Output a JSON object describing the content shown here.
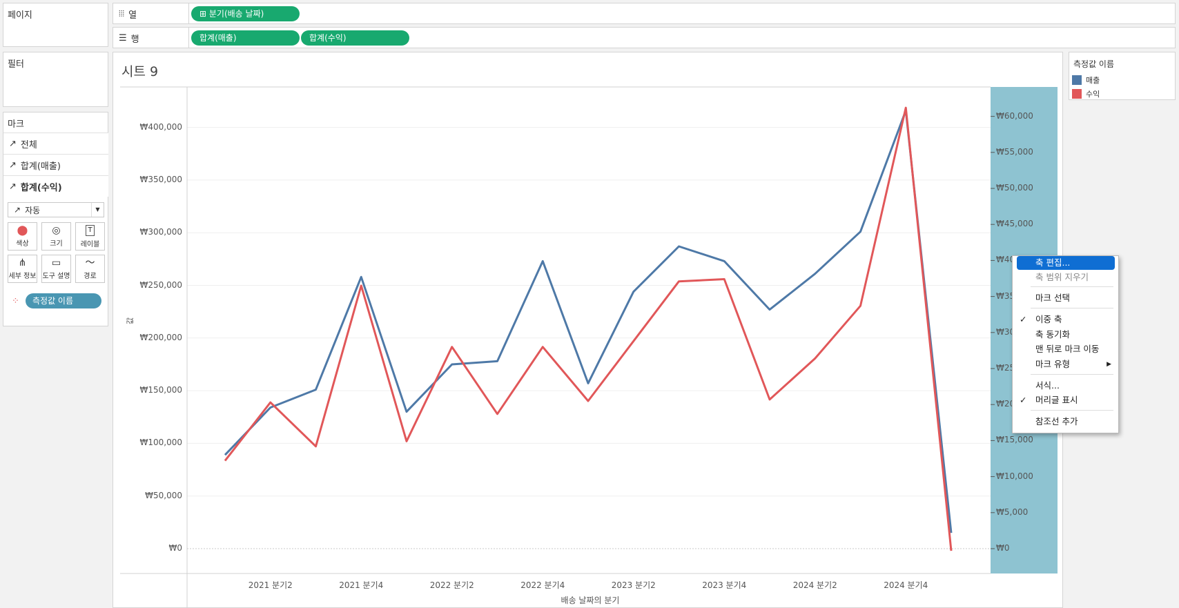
{
  "colors": {
    "sales": "#4e79a7",
    "profit": "#e15759",
    "pill": "#18a96f",
    "measure_pill": "#4996b2",
    "axis_highlight": "#8ec3d1",
    "menu_selected": "#0f6ed3"
  },
  "pages_shelf": {
    "label": "페이지"
  },
  "filters_shelf": {
    "label": "필터"
  },
  "columns_shelf": {
    "icon": "columns-icon",
    "label": "열",
    "pills": [
      "⊞ 분기(배송 날짜)"
    ]
  },
  "rows_shelf": {
    "icon": "rows-icon",
    "label": "행",
    "pills": [
      "합계(매출)",
      "합계(수익)"
    ]
  },
  "marks": {
    "label": "마크",
    "cards": [
      "전체",
      "합계(매출)",
      "합계(수익)"
    ],
    "mark_type": "자동",
    "buttons": [
      "색상",
      "크기",
      "레이블",
      "세부 정보",
      "도구 설명",
      "경로"
    ],
    "color_pill": "측정값 이름"
  },
  "sheet": {
    "title": "시트 9"
  },
  "legend": {
    "title": "측정값 이름",
    "items": [
      {
        "label": "매출",
        "color": "#4e79a7"
      },
      {
        "label": "수익",
        "color": "#e15759"
      }
    ]
  },
  "context_menu": {
    "items": [
      {
        "label": "축 편집...",
        "state": "selected"
      },
      {
        "label": "축 범위 지우기",
        "state": "disabled"
      },
      {
        "label": "마크 선택"
      },
      {
        "label": "이중 축",
        "checked": true
      },
      {
        "label": "축 동기화"
      },
      {
        "label": "맨 뒤로 마크 이동"
      },
      {
        "label": "마크 유형",
        "submenu": true
      },
      {
        "label": "서식..."
      },
      {
        "label": "머리글 표시",
        "checked": true
      },
      {
        "label": "참조선 추가"
      }
    ]
  },
  "chart_data": {
    "type": "line",
    "xlabel": "배송 날짜의 분기",
    "ylabel": "값",
    "x_tick_labels": [
      "2021 분기2",
      "2021 분기4",
      "2022 분기2",
      "2022 분기4",
      "2023 분기2",
      "2023 분기4",
      "2024 분기2",
      "2024 분기4"
    ],
    "categories": [
      "2021 Q1",
      "2021 Q2",
      "2021 Q3",
      "2021 Q4",
      "2022 Q1",
      "2022 Q2",
      "2022 Q3",
      "2022 Q4",
      "2023 Q1",
      "2023 Q2",
      "2023 Q3",
      "2023 Q4",
      "2024 Q1",
      "2024 Q2",
      "2024 Q3",
      "2024 Q4",
      "2025 Q1"
    ],
    "left_axis": {
      "ylim": [
        0,
        430000
      ],
      "ticks": [
        0,
        50000,
        100000,
        150000,
        200000,
        250000,
        300000,
        350000,
        400000
      ],
      "tick_labels": [
        "₩0",
        "₩50,000",
        "₩100,000",
        "₩150,000",
        "₩200,000",
        "₩250,000",
        "₩300,000",
        "₩350,000",
        "₩400,000"
      ]
    },
    "right_axis": {
      "ylim": [
        0,
        64500
      ],
      "ticks": [
        0,
        5000,
        10000,
        15000,
        20000,
        25000,
        30000,
        35000,
        40000,
        45000,
        50000,
        55000,
        60000
      ],
      "tick_labels": [
        "₩0",
        "₩5,000",
        "₩10,000",
        "₩15,000",
        "₩20,000",
        "₩25,000",
        "₩30,000",
        "₩35,000",
        "₩40,000",
        "₩45,000",
        "₩50,000",
        "₩55,000",
        "₩60,000"
      ]
    },
    "series": [
      {
        "name": "매출",
        "axis": "left",
        "values": [
          89000,
          134000,
          151000,
          258000,
          130000,
          175000,
          178000,
          273000,
          157000,
          244000,
          287000,
          273000,
          227000,
          261000,
          301000,
          416000,
          15000
        ]
      },
      {
        "name": "수익",
        "axis": "right",
        "values": [
          12200,
          20300,
          14200,
          36500,
          14900,
          28000,
          18700,
          28000,
          20500,
          28800,
          37100,
          37400,
          20700,
          26400,
          33700,
          61200,
          -300
        ]
      }
    ],
    "grid": true
  }
}
